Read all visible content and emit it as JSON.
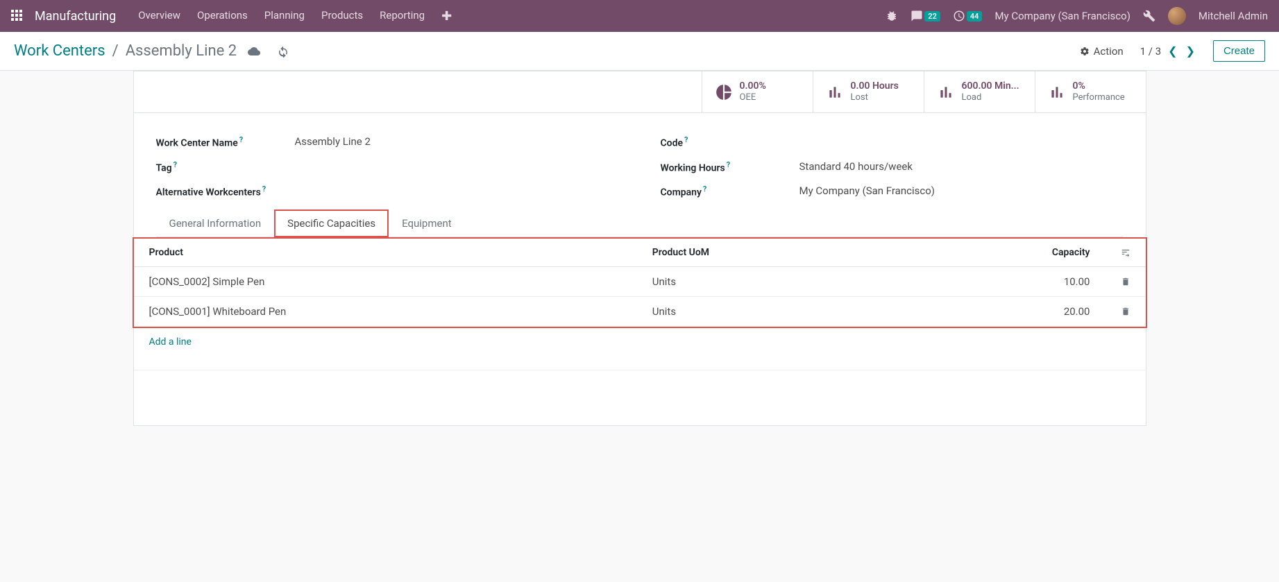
{
  "topnav": {
    "app_name": "Manufacturing",
    "menu": [
      "Overview",
      "Operations",
      "Planning",
      "Products",
      "Reporting"
    ],
    "messages_badge": "22",
    "activities_badge": "44",
    "company": "My Company (San Francisco)",
    "user": "Mitchell Admin"
  },
  "breadcrumb": {
    "root": "Work Centers",
    "current": "Assembly Line 2"
  },
  "control": {
    "action_label": "Action",
    "pager": "1 / 3",
    "create_label": "Create"
  },
  "stats": {
    "oee": {
      "value": "0.00%",
      "label": "OEE"
    },
    "lost": {
      "value": "0.00 Hours",
      "label": "Lost"
    },
    "load": {
      "value": "600.00 Min...",
      "label": "Load"
    },
    "perf": {
      "value": "0%",
      "label": "Performance"
    }
  },
  "form": {
    "name_label": "Work Center Name",
    "name_value": "Assembly Line 2",
    "tag_label": "Tag",
    "tag_value": "",
    "alt_label": "Alternative Workcenters",
    "alt_value": "",
    "code_label": "Code",
    "code_value": "",
    "hours_label": "Working Hours",
    "hours_value": "Standard 40 hours/week",
    "company_label": "Company",
    "company_value": "My Company (San Francisco)"
  },
  "tabs": [
    "General Information",
    "Specific Capacities",
    "Equipment"
  ],
  "table": {
    "headers": {
      "product": "Product",
      "uom": "Product UoM",
      "capacity": "Capacity"
    },
    "rows": [
      {
        "product": "[CONS_0002] Simple Pen",
        "uom": "Units",
        "capacity": "10.00"
      },
      {
        "product": "[CONS_0001] Whiteboard Pen",
        "uom": "Units",
        "capacity": "20.00"
      }
    ],
    "add_line": "Add a line"
  }
}
